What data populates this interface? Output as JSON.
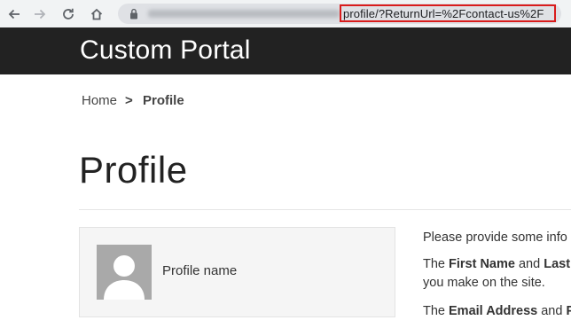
{
  "browser": {
    "url_visible": "profile/?ReturnUrl=%2Fcontact-us%2F",
    "icons": [
      "back-arrow-icon",
      "forward-arrow-icon",
      "reload-icon",
      "home-icon",
      "lock-icon"
    ]
  },
  "header": {
    "brand": "Custom Portal"
  },
  "breadcrumb": {
    "home": "Home",
    "separator": ">",
    "current": "Profile"
  },
  "page": {
    "title": "Profile"
  },
  "profile_card": {
    "name_label": "Profile name"
  },
  "info": {
    "line1": "Please provide some info",
    "line2_pre": "The ",
    "line2_b1": "First Name",
    "line2_mid": " and ",
    "line2_b2": "Last",
    "line3": "you make on the site.",
    "line4_pre": "The ",
    "line4_b1": "Email Address",
    "line4_mid": " and ",
    "line4_b2": "P"
  },
  "colors": {
    "header_bg": "#222222",
    "highlight": "#d91c1c",
    "chrome_bg": "#f1f3f4"
  }
}
